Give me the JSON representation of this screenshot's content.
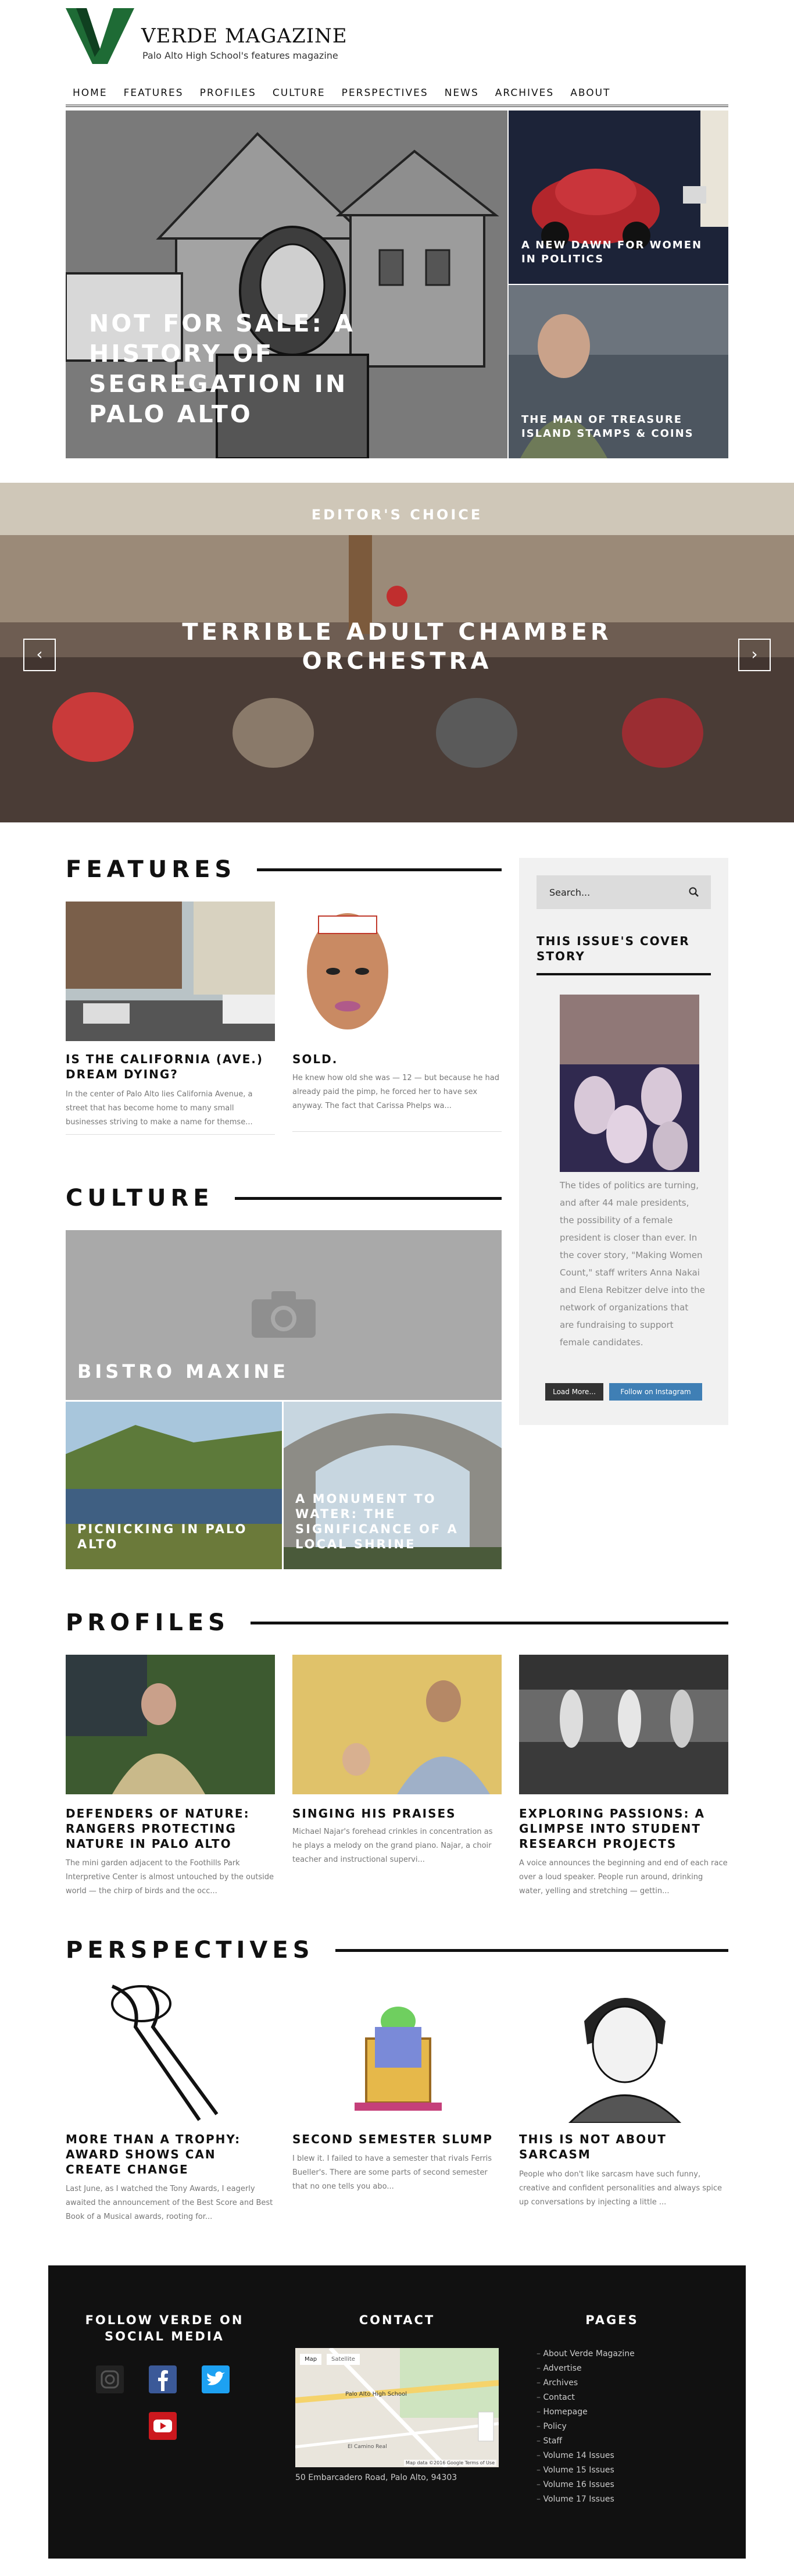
{
  "header": {
    "brand": "VERDE MAGAZINE",
    "tagline": "Palo Alto High School's features magazine",
    "logo_color": "#1e6b35"
  },
  "nav": [
    "HOME",
    "FEATURES",
    "PROFILES",
    "CULTURE",
    "PERSPECTIVES",
    "NEWS",
    "ARCHIVES",
    "ABOUT"
  ],
  "hero": {
    "main_title": "NOT FOR SALE: A HISTORY OF SEGREGATION IN PALO ALTO",
    "side": [
      {
        "title": "A NEW DAWN FOR WOMEN IN POLITICS"
      },
      {
        "title": "THE MAN OF TREASURE ISLAND STAMPS & COINS"
      }
    ]
  },
  "editors_choice": {
    "label": "EDITOR'S CHOICE",
    "title": "TERRIBLE ADULT CHAMBER ORCHESTRA",
    "prev_icon": "‹",
    "next_icon": "›"
  },
  "features": {
    "heading": "FEATURES",
    "items": [
      {
        "title": "IS THE CALIFORNIA (AVE.) DREAM DYING?",
        "excerpt": "In the center of Palo Alto lies California Avenue, a street that has become home to many small businesses striving to make a name for themse..."
      },
      {
        "title": "SOLD.",
        "excerpt": "He knew how old she was — 12 — but because he had already paid the pimp, he forced her to have sex anyway. The fact that Carissa Phelps wa..."
      }
    ]
  },
  "sidebar": {
    "search_placeholder": "Search...",
    "cover_heading": "THIS ISSUE'S COVER STORY",
    "cover_text": "The tides of politics are turning, and after 44 male presidents, the possibility of a female president is closer than ever. In the cover story, \"Making Women Count,\" staff writers Anna Nakai and Elena Rebitzer delve into the network of organizations that are fundraising to support female candidates.",
    "load_more": "Load More...",
    "follow_instagram": "Follow on Instagram"
  },
  "culture": {
    "heading": "CULTURE",
    "big_title": "BISTRO MAXINE",
    "items": [
      {
        "title": "PICNICKING IN PALO ALTO"
      },
      {
        "title": "A MONUMENT TO WATER: THE SIGNIFICANCE OF A LOCAL SHRINE"
      }
    ]
  },
  "profiles": {
    "heading": "PROFILES",
    "items": [
      {
        "title": "DEFENDERS OF NATURE: RANGERS PROTECTING NATURE IN PALO ALTO",
        "excerpt": "The mini garden adjacent to the Foothills Park Interpretive Center is almost untouched by the outside world — the chirp of birds and the occ..."
      },
      {
        "title": "SINGING HIS PRAISES",
        "excerpt": "Michael Najar's forehead crinkles in concentration as he plays a melody on the grand piano. Najar, a choir teacher and instructional supervi..."
      },
      {
        "title": "EXPLORING PASSIONS: A GLIMPSE INTO STUDENT RESEARCH PROJECTS",
        "excerpt": "A voice announces the beginning and end of each race over a loud speaker. People run around, drinking water, yelling and stretching — gettin..."
      }
    ]
  },
  "perspectives": {
    "heading": "PERSPECTIVES",
    "items": [
      {
        "title": "MORE THAN A TROPHY: AWARD SHOWS CAN CREATE CHANGE",
        "excerpt": "Last June, as I watched the Tony Awards, I eagerly awaited the announcement of the Best Score and Best Book of a Musical awards, rooting for..."
      },
      {
        "title": "SECOND SEMESTER SLUMP",
        "excerpt": "I blew it. I failed to have a semester that rivals Ferris Bueller's. There are some parts of second semester that no one tells you abo..."
      },
      {
        "title": "THIS IS NOT ABOUT SARCASM",
        "excerpt": "People who don't like sarcasm have such funny, creative and confident personalities and always spice up conversations by injecting a little ..."
      }
    ]
  },
  "footer": {
    "social_heading": "FOLLOW VERDE ON SOCIAL MEDIA",
    "contact_heading": "CONTACT",
    "pages_heading": "PAGES",
    "map": {
      "tab_map": "Map",
      "tab_satellite": "Satellite",
      "place": "Palo Alto High School",
      "attrib": "Map data ©2016 Google   Terms of Use",
      "street": "El Camino Real"
    },
    "address": "50 Embarcadero Road, Palo Alto, 94303",
    "pages": [
      "About Verde Magazine",
      "Advertise",
      "Archives",
      "Contact",
      "Homepage",
      "Policy",
      "Staff",
      "Volume 14 Issues",
      "Volume 15 Issues",
      "Volume 16 Issues",
      "Volume 17 Issues"
    ]
  }
}
